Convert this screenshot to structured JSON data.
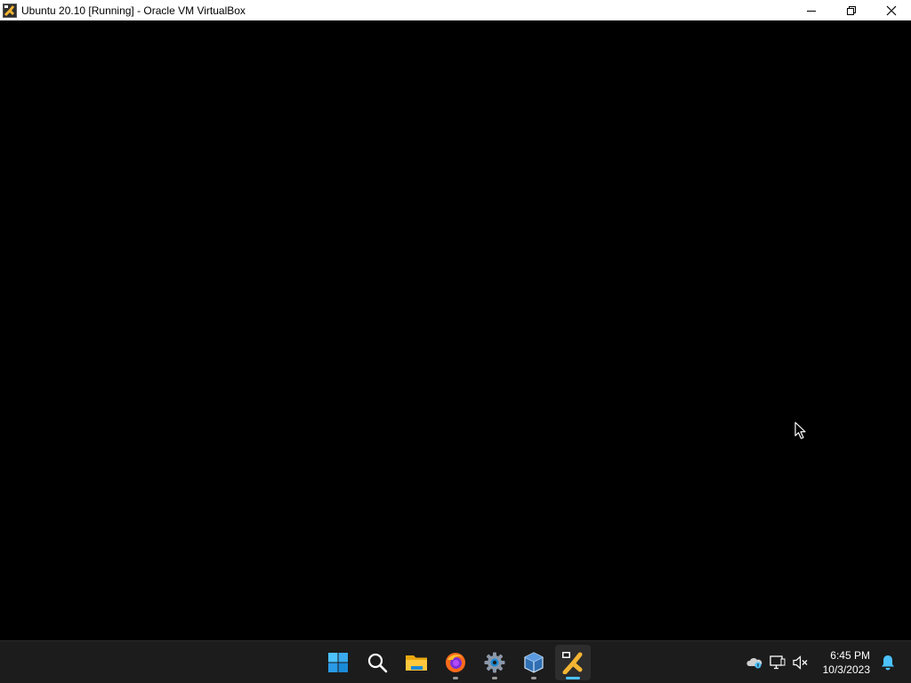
{
  "window": {
    "title": "Ubuntu 20.10 [Running] - Oracle VM VirtualBox",
    "icon": "virtualbox-vm-icon",
    "controls": [
      "minimize-icon",
      "restore-icon",
      "close-icon"
    ]
  },
  "taskbar": {
    "apps": [
      {
        "name": "start",
        "icon": "windows-start-icon",
        "running": false,
        "active": false
      },
      {
        "name": "search",
        "icon": "search-icon",
        "running": false,
        "active": false
      },
      {
        "name": "file-explorer",
        "icon": "folder-icon",
        "running": false,
        "active": false
      },
      {
        "name": "firefox",
        "icon": "firefox-icon",
        "running": true,
        "active": false
      },
      {
        "name": "settings",
        "icon": "gear-icon",
        "running": true,
        "active": false
      },
      {
        "name": "virtualbox-manager",
        "icon": "virtualbox-icon",
        "running": true,
        "active": false
      },
      {
        "name": "virtualbox-vm",
        "icon": "virtualbox-vm-icon",
        "running": true,
        "active": true
      }
    ],
    "tray": {
      "icons": [
        "onedrive-icon",
        "network-icon",
        "volume-muted-icon"
      ],
      "time": "6:45 PM",
      "date": "10/3/2023",
      "notification_icon": "bell-icon"
    }
  },
  "colors": {
    "accent": "#4cc2ff",
    "taskbar_bg": "#1c1c1c",
    "vm_screen": "#000000"
  }
}
